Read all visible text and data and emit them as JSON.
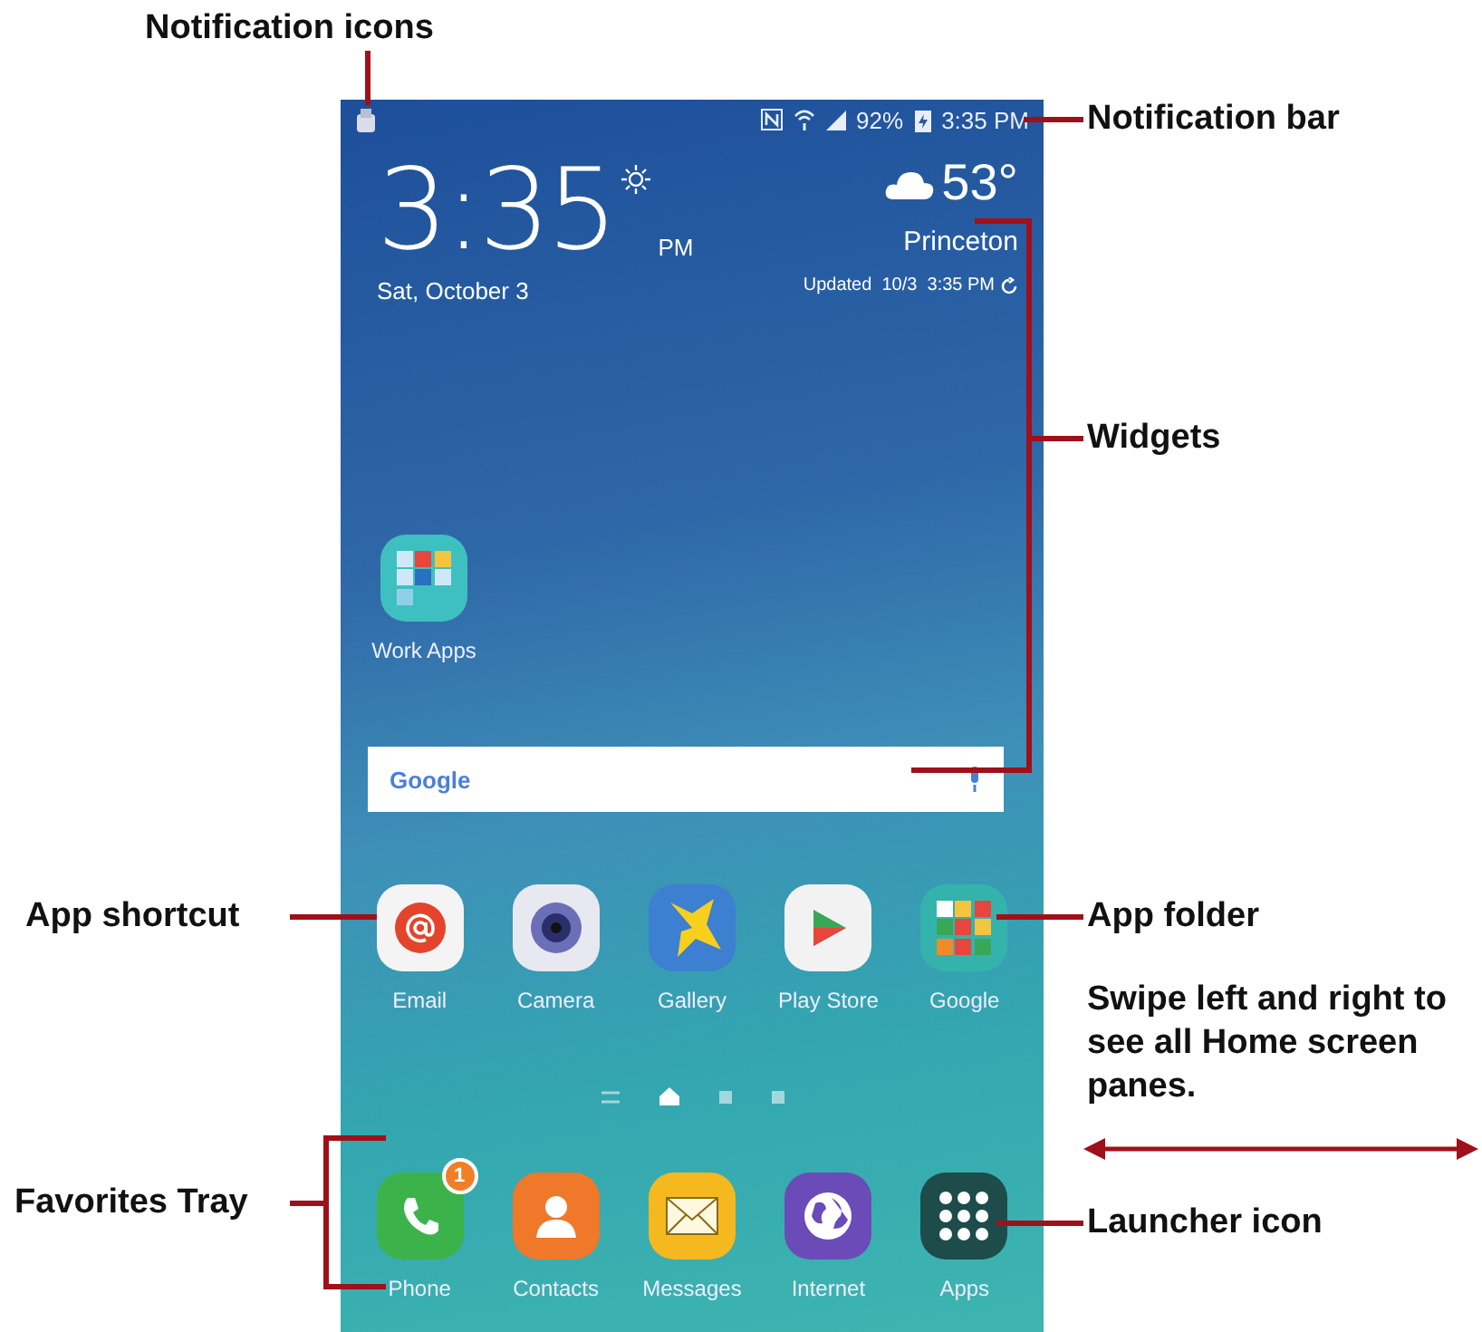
{
  "callouts": [
    {
      "kind": "notification_icons",
      "label": "Notification icons"
    },
    {
      "kind": "notification_bar",
      "label": "Notification bar"
    },
    {
      "kind": "widgets",
      "label": "Widgets"
    },
    {
      "kind": "app_shortcut",
      "label": "App shortcut"
    },
    {
      "kind": "app_folder",
      "label": "App folder"
    },
    {
      "kind": "swipe",
      "label": "Swipe left and right to see all Home screen panes."
    },
    {
      "kind": "favorites_tray",
      "label": "Favorites Tray"
    },
    {
      "kind": "launcher",
      "label": "Launcher icon"
    }
  ],
  "status_bar": {
    "battery": "92%",
    "time": "3:35 PM"
  },
  "clock_widget": {
    "time": "3:35",
    "ampm": "PM",
    "date": "Sat, October 3"
  },
  "weather_widget": {
    "temperature": "53°",
    "city": "Princeton",
    "updated": "Updated  10/3  3:35 PM"
  },
  "folder": {
    "label": "Work Apps"
  },
  "search_bar": {
    "logo": "Google"
  },
  "apps": [
    {
      "kind": "email",
      "label": "Email"
    },
    {
      "kind": "camera",
      "label": "Camera"
    },
    {
      "kind": "gallery",
      "label": "Gallery"
    },
    {
      "kind": "store",
      "label": "Play Store"
    },
    {
      "kind": "folder",
      "label": "Google"
    }
  ],
  "pages": [
    {
      "kind": "menu",
      "selected": false
    },
    {
      "kind": "home",
      "selected": true
    },
    {
      "kind": "dot",
      "selected": false
    },
    {
      "kind": "dot",
      "selected": false
    }
  ],
  "dock": [
    {
      "kind": "phone",
      "label": "Phone",
      "badge": "1"
    },
    {
      "kind": "contacts",
      "label": "Contacts"
    },
    {
      "kind": "messages",
      "label": "Messages"
    },
    {
      "kind": "internet",
      "label": "Internet"
    },
    {
      "kind": "apps",
      "label": "Apps"
    }
  ]
}
